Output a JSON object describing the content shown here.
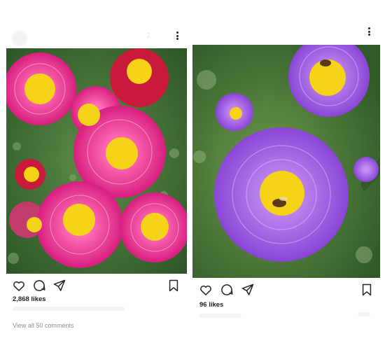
{
  "posts": [
    {
      "id_label": "left",
      "faint_username": "2",
      "likes_text": "2,868 likes",
      "comments_link": "View all 50 comments",
      "photo_icon": "pink-daisy-flowers-photo"
    },
    {
      "id_label": "right",
      "faint_username": "",
      "likes_text": "96 likes",
      "comments_link": "",
      "photo_icon": "purple-aster-bee-photo"
    }
  ],
  "icons": {
    "like": "heart-icon",
    "comment": "comment-icon",
    "share": "paper-plane-icon",
    "save": "bookmark-icon",
    "more": "more-vertical-icon"
  },
  "colors": {
    "text": "#262626",
    "secondary": "#8e8e8e",
    "pink_petal": "#e8338f",
    "purple_petal": "#a15fe0",
    "flower_center": "#f5d318",
    "foliage": "#3d6b33"
  }
}
